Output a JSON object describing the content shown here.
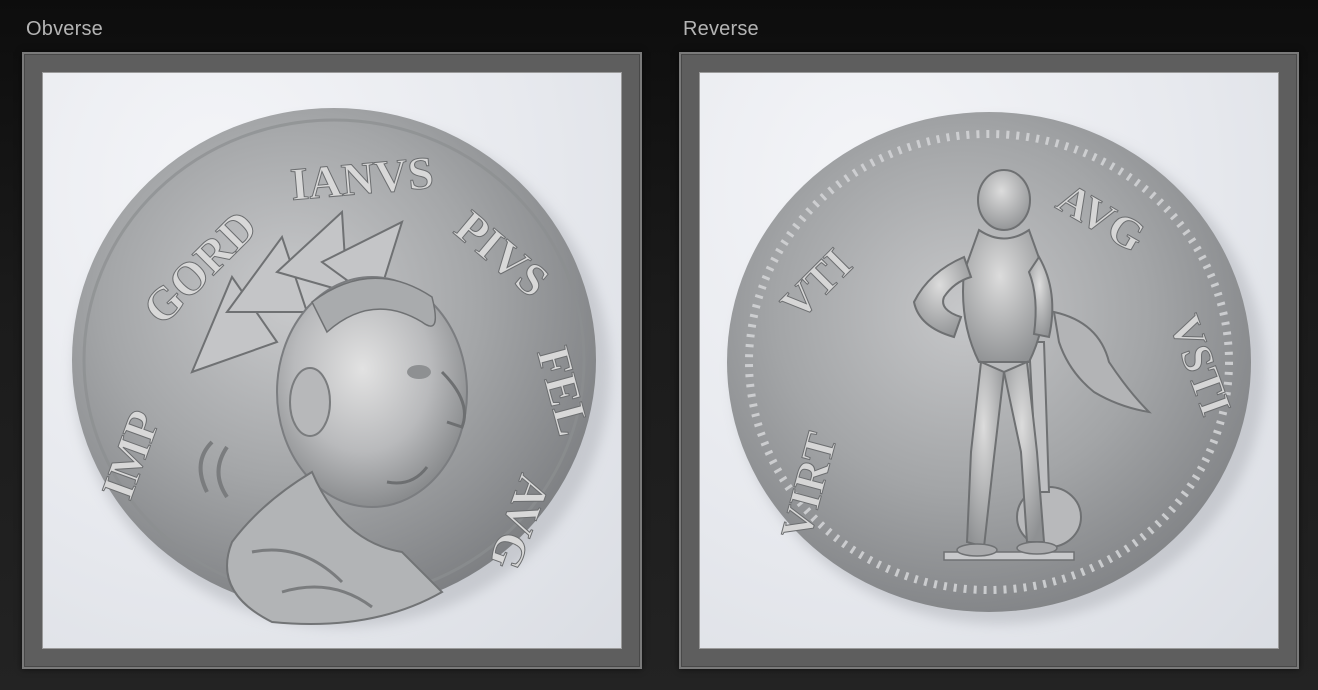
{
  "panels": {
    "obverse": {
      "label": "Obverse",
      "image_subject": "obverse-coin-photo"
    },
    "reverse": {
      "label": "Reverse",
      "image_subject": "reverse-coin-photo"
    }
  },
  "colors": {
    "background": "#161616",
    "label_text": "#b4b4b4",
    "frame": "#5e5e5e",
    "photo_background": "#e7e9ee",
    "coin_silver": "#a7a9ab"
  }
}
